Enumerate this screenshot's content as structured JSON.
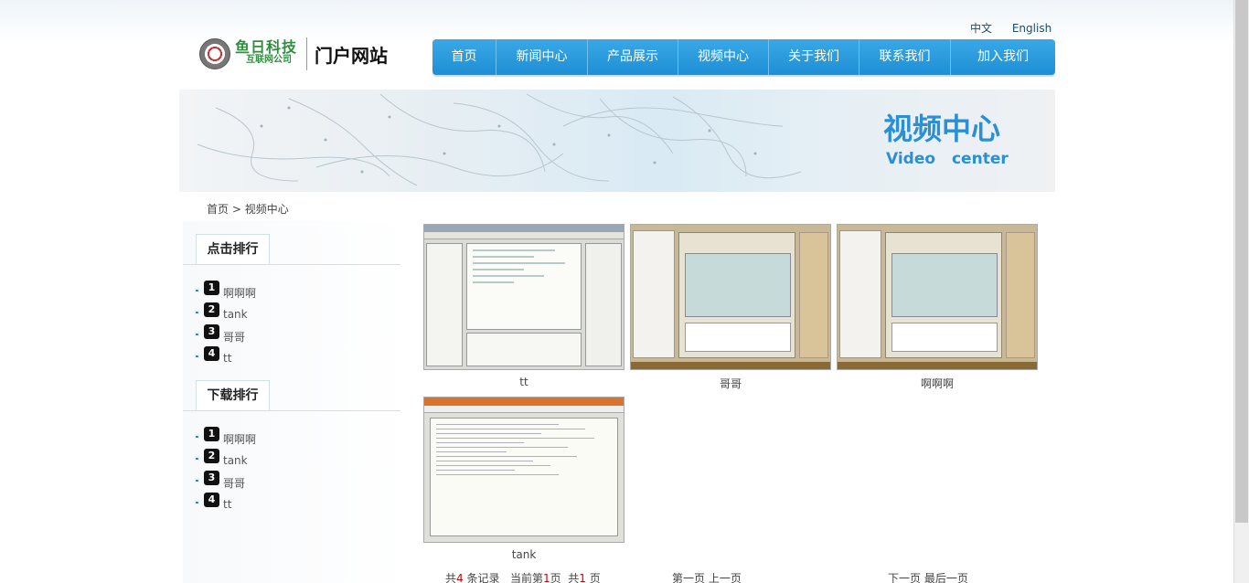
{
  "lang": {
    "zh": "中文",
    "en": "English"
  },
  "logo": {
    "brand_top": "鱼日科技",
    "brand_bottom": "互联网公司",
    "portal": "门户网站"
  },
  "nav": {
    "items": [
      {
        "label": "首页"
      },
      {
        "label": "新闻中心"
      },
      {
        "label": "产品展示"
      },
      {
        "label": "视频中心"
      },
      {
        "label": "关于我们"
      },
      {
        "label": "联系我们"
      },
      {
        "label": "加入我们"
      }
    ]
  },
  "banner": {
    "title_cn": "视频中心",
    "title_en": "Video  center"
  },
  "breadcrumb": {
    "home": "首页",
    "sep": " > ",
    "current": "视频中心"
  },
  "sidebar": {
    "click_rank": {
      "title": "点击排行",
      "items": [
        {
          "num": "1",
          "label": "啊啊啊"
        },
        {
          "num": "2",
          "label": "tank"
        },
        {
          "num": "3",
          "label": "哥哥"
        },
        {
          "num": "4",
          "label": "tt"
        }
      ]
    },
    "download_rank": {
      "title": "下载排行",
      "items": [
        {
          "num": "1",
          "label": "啊啊啊"
        },
        {
          "num": "2",
          "label": "tank"
        },
        {
          "num": "3",
          "label": "哥哥"
        },
        {
          "num": "4",
          "label": "tt"
        }
      ]
    }
  },
  "videos": [
    {
      "caption": "tt",
      "thumb": "ide-screenshot"
    },
    {
      "caption": "哥哥",
      "thumb": "chat-screenshot"
    },
    {
      "caption": "啊啊啊",
      "thumb": "chat-screenshot"
    },
    {
      "caption": "tank",
      "thumb": "code-screenshot"
    }
  ],
  "pager": {
    "total_prefix": "共",
    "total_count": "4",
    "total_suffix": " 条记录",
    "current_prefix": "当前第",
    "current_page": "1",
    "current_suffix": "页",
    "pages_prefix": "共",
    "pages_count": "1",
    "pages_suffix": " 页",
    "first": "第一页",
    "prev": "上一页",
    "next": "下一页",
    "last": "最后一页"
  },
  "colors": {
    "accent": "#2b8fd6",
    "nav_bg": "#2a9be0",
    "highlight": "#cc0000"
  }
}
